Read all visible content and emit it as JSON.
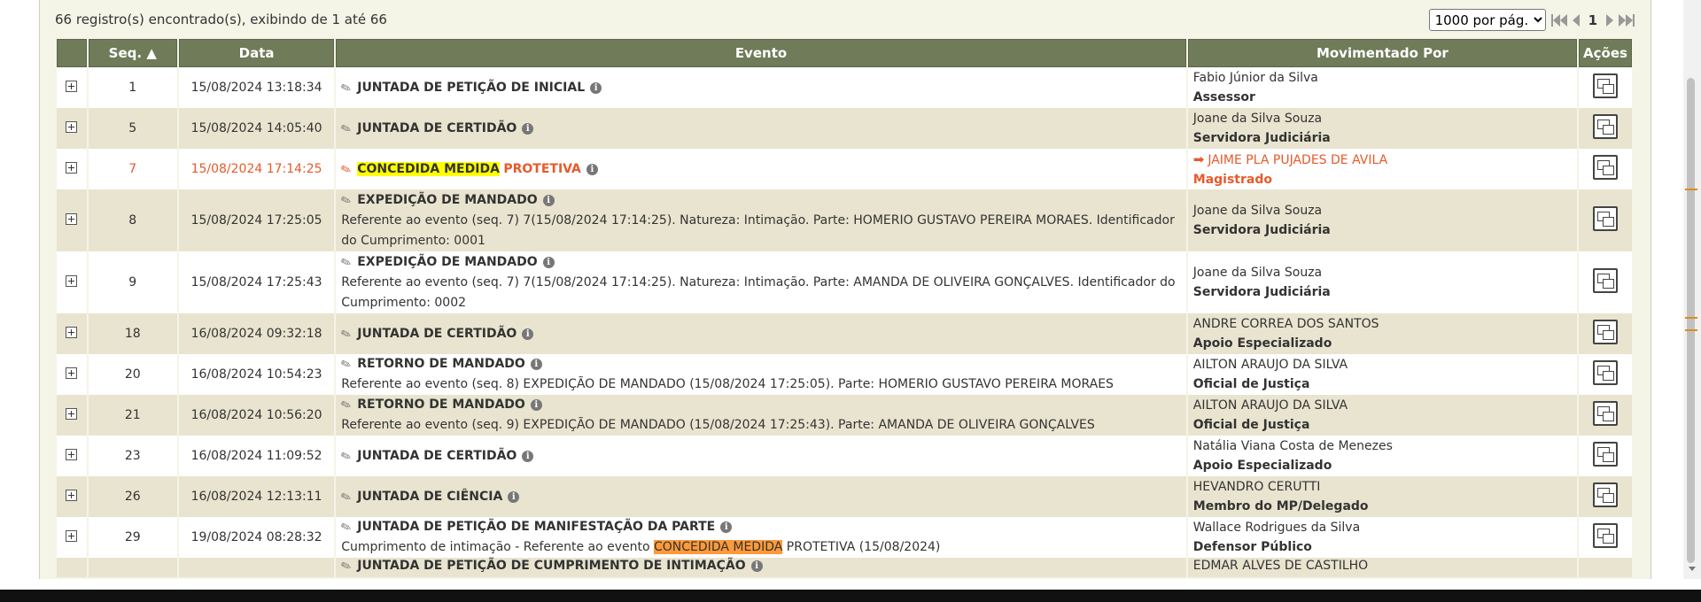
{
  "summary": "66 registro(s) encontrado(s), exibindo de 1 até 66",
  "pager": {
    "page_size": "1000 por pág.",
    "page_size_options": [
      "1000 por pág."
    ],
    "current_page": "1"
  },
  "columns": {
    "seq": "Seq.",
    "data": "Data",
    "evento": "Evento",
    "movimentado": "Movimentado Por",
    "acoes": "Ações"
  },
  "rows": [
    {
      "seq": "1",
      "date": "15/08/2024 13:18:34",
      "title": "JUNTADA DE PETIÇÃO DE INICIAL",
      "desc": "",
      "name": "Fabio Júnior da Silva",
      "role": "Assessor"
    },
    {
      "seq": "5",
      "date": "15/08/2024 14:05:40",
      "title": "JUNTADA DE CERTIDÃO",
      "desc": "",
      "name": "Joane da Silva Souza",
      "role": "Servidora Judiciária"
    },
    {
      "seq": "7",
      "date": "15/08/2024 17:14:25",
      "title_hl": "CONCEDIDA MEDIDA",
      "title_rest": "PROTETIVA",
      "name": "JAIME PLA PUJADES DE AVILA",
      "role": "Magistrado"
    },
    {
      "seq": "8",
      "date": "15/08/2024 17:25:05",
      "title": "EXPEDIÇÃO DE MANDADO",
      "desc": "Referente ao evento (seq. 7) 7(15/08/2024 17:14:25). Natureza: Intimação. Parte: HOMERIO GUSTAVO PEREIRA MORAES. Identificador do Cumprimento: 0001",
      "name": "Joane da Silva Souza",
      "role": "Servidora Judiciária"
    },
    {
      "seq": "9",
      "date": "15/08/2024 17:25:43",
      "title": "EXPEDIÇÃO DE MANDADO",
      "desc": "Referente ao evento (seq. 7) 7(15/08/2024 17:14:25). Natureza: Intimação. Parte: AMANDA DE OLIVEIRA GONÇALVES. Identificador do Cumprimento: 0002",
      "name": "Joane da Silva Souza",
      "role": "Servidora Judiciária"
    },
    {
      "seq": "18",
      "date": "16/08/2024 09:32:18",
      "title": "JUNTADA DE CERTIDÃO",
      "desc": "",
      "name": "ANDRE CORREA DOS SANTOS",
      "role": "Apoio Especializado"
    },
    {
      "seq": "20",
      "date": "16/08/2024 10:54:23",
      "title": "RETORNO DE MANDADO",
      "desc": "Referente ao evento (seq. 8) EXPEDIÇÃO DE MANDADO (15/08/2024 17:25:05). Parte: HOMERIO GUSTAVO PEREIRA MORAES",
      "name": "AILTON ARAUJO DA SILVA",
      "role": "Oficial de Justiça"
    },
    {
      "seq": "21",
      "date": "16/08/2024 10:56:20",
      "title": "RETORNO DE MANDADO",
      "desc": "Referente ao evento (seq. 9) EXPEDIÇÃO DE MANDADO (15/08/2024 17:25:43). Parte: AMANDA DE OLIVEIRA GONÇALVES",
      "name": "AILTON ARAUJO DA SILVA",
      "role": "Oficial de Justiça"
    },
    {
      "seq": "23",
      "date": "16/08/2024 11:09:52",
      "title": "JUNTADA DE CERTIDÃO",
      "desc": "",
      "name": "Natália Viana Costa de Menezes",
      "role": "Apoio Especializado"
    },
    {
      "seq": "26",
      "date": "16/08/2024 12:13:11",
      "title": "JUNTADA DE CIÊNCIA",
      "desc": "",
      "name": "HEVANDRO CERUTTI",
      "role": "Membro do MP/Delegado"
    },
    {
      "seq": "29",
      "date": "19/08/2024 08:28:32",
      "title": "JUNTADA DE PETIÇÃO DE MANIFESTAÇÃO DA PARTE",
      "desc_pre": "Cumprimento de intimação - Referente ao evento",
      "desc_hl": "CONCEDIDA MEDIDA",
      "desc_post": "PROTETIVA (15/08/2024)",
      "name": "Wallace Rodrigues da Silva",
      "role": "Defensor Público"
    },
    {
      "seq": "",
      "date": "",
      "title": "JUNTADA DE PETIÇÃO DE CUMPRIMENTO DE INTIMAÇÃO",
      "desc": "",
      "name": "EDMAR ALVES DE CASTILHO",
      "role": ""
    }
  ],
  "icons": {
    "expand": "plus-square-icon",
    "edit": "pencil-icon",
    "info": "info-circle-icon",
    "action": "documents-icon",
    "arrow": "arrow-right-icon",
    "sort": "sort-asc-icon"
  },
  "colors": {
    "header_bg": "#6f7b59",
    "row_alt_bg": "#e8e4cf",
    "highlight_yellow": "#ffff00",
    "highlight_orange": "#ff9a3a",
    "magistrate_text": "#e75a2b"
  }
}
